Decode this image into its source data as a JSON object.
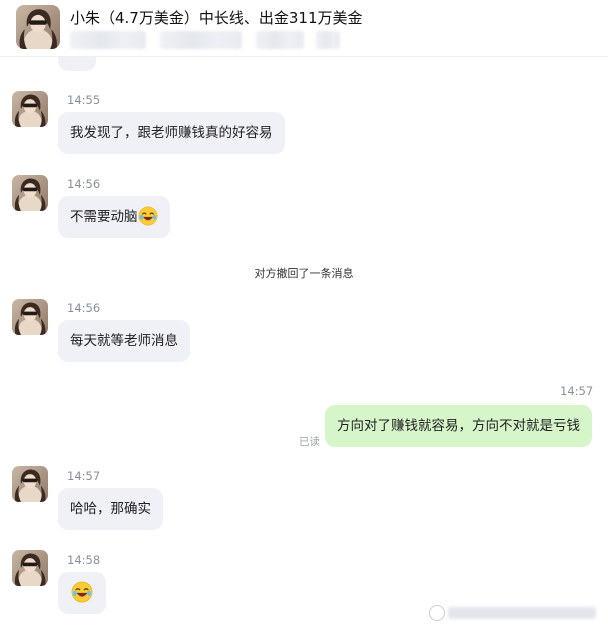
{
  "header": {
    "contact_name": "小朱（4.7万美金）中长线、出金311万美金",
    "avatar_icon": "contact-avatar-photo"
  },
  "messages": [
    {
      "time": "14:55",
      "text": "我发现了，跟老师赚钱真的好容易",
      "from": "them"
    },
    {
      "time": "14:56",
      "text": "不需要动脑",
      "emoji": "laughing-tears-emoji",
      "from": "them"
    },
    {
      "system": "对方撤回了一条消息"
    },
    {
      "time": "14:56",
      "text": "每天就等老师消息",
      "from": "them"
    },
    {
      "time": "14:57",
      "text": "方向对了赚钱就容易，方向不对就是亏钱",
      "from": "me",
      "status": "已读"
    },
    {
      "time": "14:57",
      "text": "哈哈，那确实",
      "from": "them"
    },
    {
      "time": "14:58",
      "text": "",
      "emoji": "laughing-tears-emoji",
      "from": "them"
    }
  ],
  "colors": {
    "incoming_bubble": "#f0f1f6",
    "outgoing_bubble": "#d6f5c9",
    "timestamp": "#8a8f99"
  }
}
